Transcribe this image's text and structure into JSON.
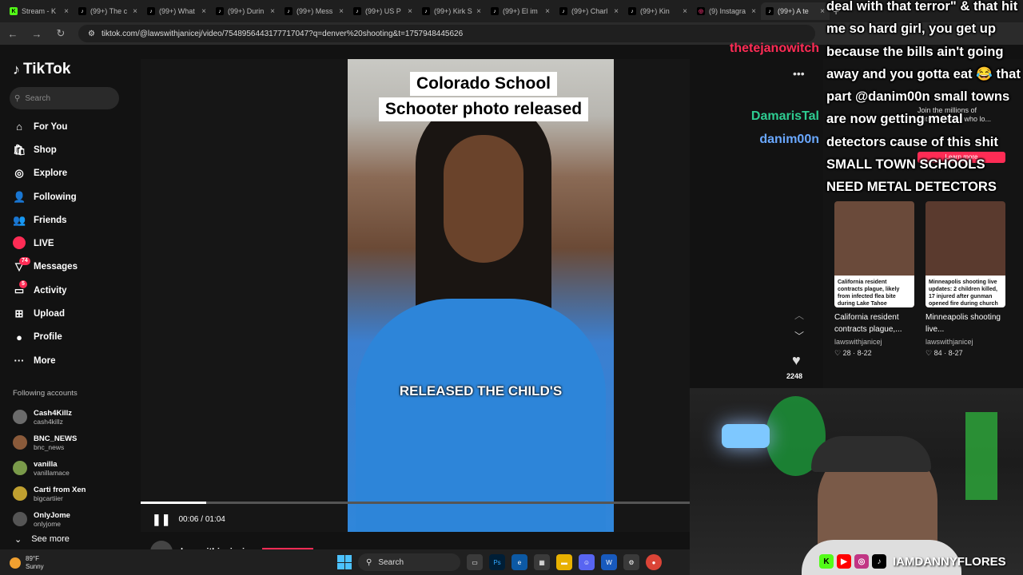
{
  "browser": {
    "tabs": [
      {
        "label": "Stream - K",
        "fav": "K",
        "fav_color": "#53fc18"
      },
      {
        "label": "(99+) The c",
        "fav": "♪",
        "fav_color": "#ffffff"
      },
      {
        "label": "(99+) What",
        "fav": "♪",
        "fav_color": "#ffffff"
      },
      {
        "label": "(99+) Durin",
        "fav": "♪",
        "fav_color": "#ffffff"
      },
      {
        "label": "(99+) Mess",
        "fav": "♪",
        "fav_color": "#ffffff"
      },
      {
        "label": "(99+) US P",
        "fav": "♪",
        "fav_color": "#ffffff"
      },
      {
        "label": "(99+) Kirk S",
        "fav": "♪",
        "fav_color": "#ffffff"
      },
      {
        "label": "(99+) El im",
        "fav": "♪",
        "fav_color": "#ffffff"
      },
      {
        "label": "(99+) Charl",
        "fav": "♪",
        "fav_color": "#ffffff"
      },
      {
        "label": "(99+) Kin",
        "fav": "♪",
        "fav_color": "#ffffff"
      },
      {
        "label": "(9) Instagra",
        "fav": "◎",
        "fav_color": "#e1306c"
      },
      {
        "label": "(99+) A te",
        "fav": "♪",
        "fav_color": "#ffffff"
      }
    ],
    "url": "tiktok.com/@lawswithjanicej/video/7548956443177717047?q=denver%20shooting&t=1757948445626"
  },
  "sidebar": {
    "logo": "TikTok",
    "search_placeholder": "Search",
    "nav": [
      {
        "label": "For You",
        "icon": "⌂",
        "name": "for-you"
      },
      {
        "label": "Shop",
        "icon": "🛍",
        "name": "shop"
      },
      {
        "label": "Explore",
        "icon": "◎",
        "name": "explore"
      },
      {
        "label": "Following",
        "icon": "👤",
        "name": "following"
      },
      {
        "label": "Friends",
        "icon": "👥",
        "name": "friends"
      },
      {
        "label": "LIVE",
        "icon": "",
        "name": "live"
      },
      {
        "label": "Messages",
        "icon": "▽",
        "name": "messages",
        "badge": "74"
      },
      {
        "label": "Activity",
        "icon": "▭",
        "name": "activity",
        "badge": "5"
      },
      {
        "label": "Upload",
        "icon": "⊞",
        "name": "upload"
      },
      {
        "label": "Profile",
        "icon": "●",
        "name": "profile"
      },
      {
        "label": "More",
        "icon": "···",
        "name": "more"
      }
    ],
    "following_header": "Following accounts",
    "accounts": [
      {
        "name": "Cash4Killz",
        "handle": "cash4killz"
      },
      {
        "name": "BNC_NEWS",
        "handle": "bnc_news"
      },
      {
        "name": "vanilla",
        "handle": "vanillamace"
      },
      {
        "name": "Carti from Xen",
        "handle": "bigcartiier"
      },
      {
        "name": "OnlyJome",
        "handle": "onlyjome"
      }
    ],
    "see_more": "See more"
  },
  "video": {
    "caption_line1": "Colorado School",
    "caption_line2": "Schooter photo released",
    "subtitle": "RELEASED THE CHILD'S",
    "time": "00:06 / 01:04",
    "progress": 0.12,
    "author": "lawswithjanicej",
    "like_count": "2248"
  },
  "chat": {
    "user1": "thetejanowitch",
    "user1_color": "#fe2c55",
    "user2": "DamarisTal",
    "user2_color": "#2ecc91",
    "user3": "danim00n",
    "user3_color": "#6aa8ff",
    "message": "deal with that terror\" & that hit me so hard girl, you get up because the bills ain't going away and you gotta eat 😂 that part @danim00n small towns are now getting metal detectors cause of this shit SMALL TOWN SCHOOLS NEED METAL DETECTORS"
  },
  "right": {
    "ad_text": "Join the millions of entrepreneurs who lo...",
    "ad_button": "Learn more",
    "videos": [
      {
        "title": "California resident contracts plague,...",
        "user": "lawswithjanicej",
        "likes": "28",
        "date": "8-22",
        "band": "California resident contracts plague, likely from infected flea bite during Lake Tahoe camping trip: officials"
      },
      {
        "title": "Minneapolis shooting live...",
        "user": "lawswithjanicej",
        "likes": "84",
        "date": "8-27",
        "band": "Minneapolis shooting live updates: 2 children killed, 17 injured after gunman opened fire during church school mass"
      }
    ]
  },
  "stream": {
    "handle": "IAMDANNYFLORES"
  },
  "taskbar": {
    "temp": "89°F",
    "cond": "Sunny",
    "search": "Search"
  }
}
